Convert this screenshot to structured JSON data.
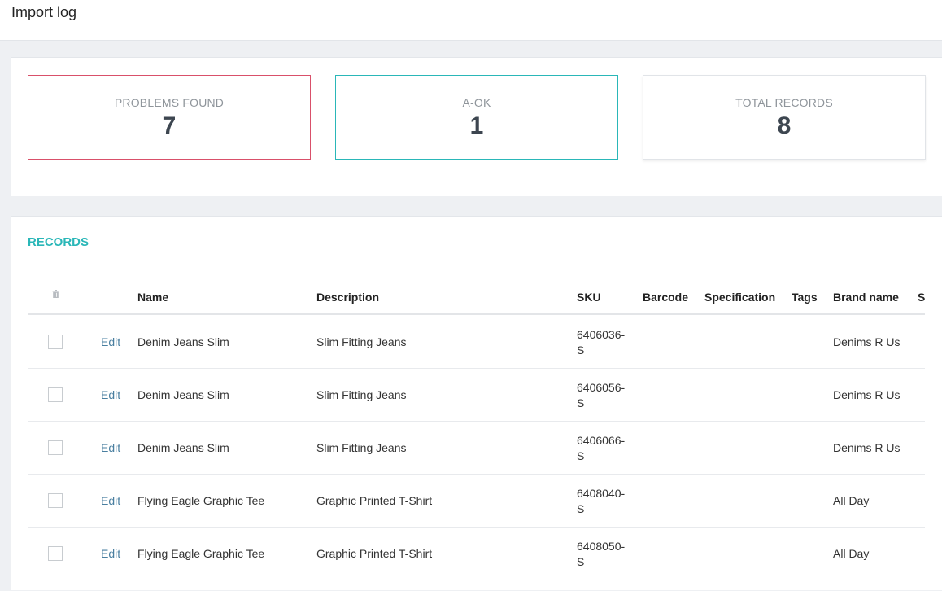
{
  "header": {
    "title": "Import log"
  },
  "stats": {
    "problems": {
      "label": "PROBLEMS FOUND",
      "value": "7"
    },
    "ok": {
      "label": "A-OK",
      "value": "1"
    },
    "total": {
      "label": "TOTAL RECORDS",
      "value": "8"
    }
  },
  "colors": {
    "problems_border": "#d9506a",
    "ok_border": "#2ab7b8",
    "accent": "#2ab7b8",
    "link": "#4a7fa0"
  },
  "records": {
    "heading": "RECORDS",
    "columns": [
      "Name",
      "Description",
      "SKU",
      "Barcode",
      "Specification",
      "Tags",
      "Brand name",
      "S"
    ],
    "edit_label": "Edit",
    "rows": [
      {
        "name": "Denim Jeans Slim",
        "description": "Slim Fitting Jeans",
        "sku": "6406036-S",
        "barcode": "",
        "specification": "",
        "tags": "",
        "brand": "Denims R Us"
      },
      {
        "name": "Denim Jeans Slim",
        "description": "Slim Fitting Jeans",
        "sku": "6406056-S",
        "barcode": "",
        "specification": "",
        "tags": "",
        "brand": "Denims R Us"
      },
      {
        "name": "Denim Jeans Slim",
        "description": "Slim Fitting Jeans",
        "sku": "6406066-S",
        "barcode": "",
        "specification": "",
        "tags": "",
        "brand": "Denims R Us"
      },
      {
        "name": "Flying Eagle Graphic Tee",
        "description": "Graphic Printed T-Shirt",
        "sku": "6408040-S",
        "barcode": "",
        "specification": "",
        "tags": "",
        "brand": "All Day"
      },
      {
        "name": "Flying Eagle Graphic Tee",
        "description": "Graphic Printed T-Shirt",
        "sku": "6408050-S",
        "barcode": "",
        "specification": "",
        "tags": "",
        "brand": "All Day"
      }
    ]
  }
}
